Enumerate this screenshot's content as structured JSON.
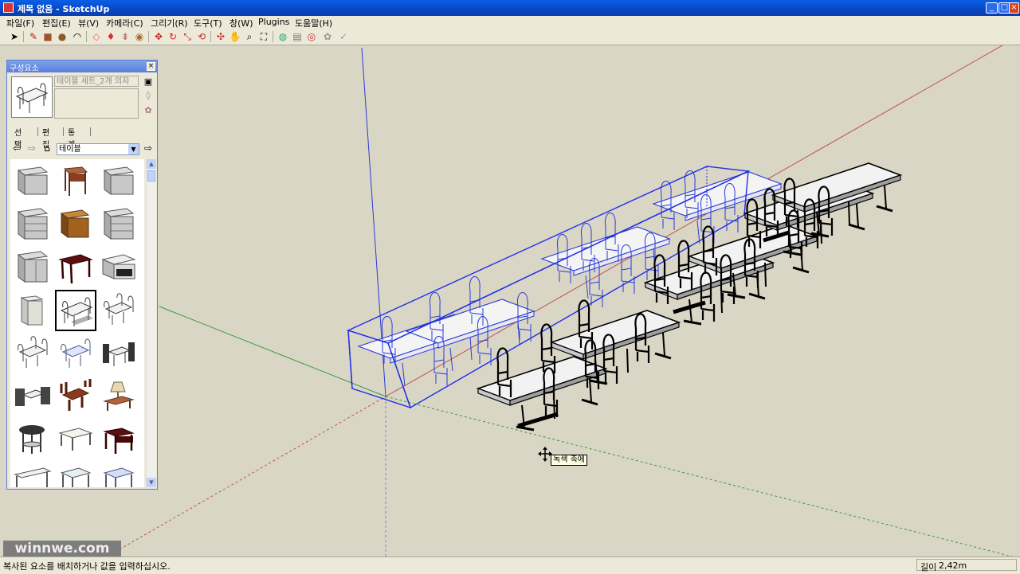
{
  "window": {
    "title": "제목 없음 - SketchUp",
    "controls": {
      "minimize": "_",
      "maximize": "□",
      "close": "×"
    }
  },
  "menu": {
    "items": [
      "파일(F)",
      "편집(E)",
      "뷰(V)",
      "카메라(C)",
      "그리기(R)",
      "도구(T)",
      "창(W)",
      "Plugins",
      "도움말(H)"
    ]
  },
  "toolbar": {
    "tools": [
      {
        "name": "select-tool-icon",
        "glyph": "➤"
      },
      {
        "name": "pencil-tool-icon",
        "glyph": "✎"
      },
      {
        "name": "rectangle-tool-icon",
        "glyph": "■"
      },
      {
        "name": "circle-tool-icon",
        "glyph": "●"
      },
      {
        "name": "arc-tool-icon",
        "glyph": "◠"
      },
      {
        "name": "eraser-tool-icon",
        "glyph": "◇"
      },
      {
        "name": "paint-bucket-tool-icon",
        "glyph": "♦"
      },
      {
        "name": "push-pull-tool-icon",
        "glyph": "⇟"
      },
      {
        "name": "offset-tool-icon",
        "glyph": "◉"
      },
      {
        "name": "move-tool-icon",
        "glyph": "✥"
      },
      {
        "name": "rotate-tool-icon",
        "glyph": "↻"
      },
      {
        "name": "scale-tool-icon",
        "glyph": "⤡"
      },
      {
        "name": "follow-me-tool-icon",
        "glyph": "⟲"
      },
      {
        "name": "orbit-tool-icon",
        "glyph": "✣"
      },
      {
        "name": "pan-tool-icon",
        "glyph": "✋"
      },
      {
        "name": "zoom-tool-icon",
        "glyph": "⌕"
      },
      {
        "name": "zoom-extents-icon",
        "glyph": "⛶"
      },
      {
        "name": "3d-warehouse-icon",
        "glyph": "◍"
      },
      {
        "name": "share-model-icon",
        "glyph": "▤"
      },
      {
        "name": "google-earth-icon",
        "glyph": "◎"
      },
      {
        "name": "components-icon",
        "glyph": "✿"
      },
      {
        "name": "dynamic-components-icon",
        "glyph": "✓"
      }
    ]
  },
  "components_panel": {
    "title": "구성요소",
    "close": "×",
    "name_field": "테이블 세트_2개 의자",
    "tabs": [
      "선택",
      "편집",
      "통계"
    ],
    "collection": "테이블",
    "dropdown_arrow": "▼",
    "nav": {
      "back": "⇦",
      "forward": "⇨",
      "home": "⌂",
      "details": "⇨"
    },
    "side_icons": [
      "▣",
      "◊",
      "✿"
    ],
    "scroll": {
      "up": "▲",
      "down": "▼"
    }
  },
  "viewport": {
    "tooltip": "녹색 축에",
    "colors": {
      "red_axis": "#c0504d",
      "green_axis": "#3c9a3c",
      "blue_axis": "#2b3bd6",
      "selection": "#1f2ee6",
      "background": "#d9d6c6"
    }
  },
  "watermark": "winnwe.com",
  "status": {
    "message": "복사된 요소를 배치하거나 값을 입력하십시오.",
    "measure_label": "길이",
    "measure_value": "2,42m"
  }
}
